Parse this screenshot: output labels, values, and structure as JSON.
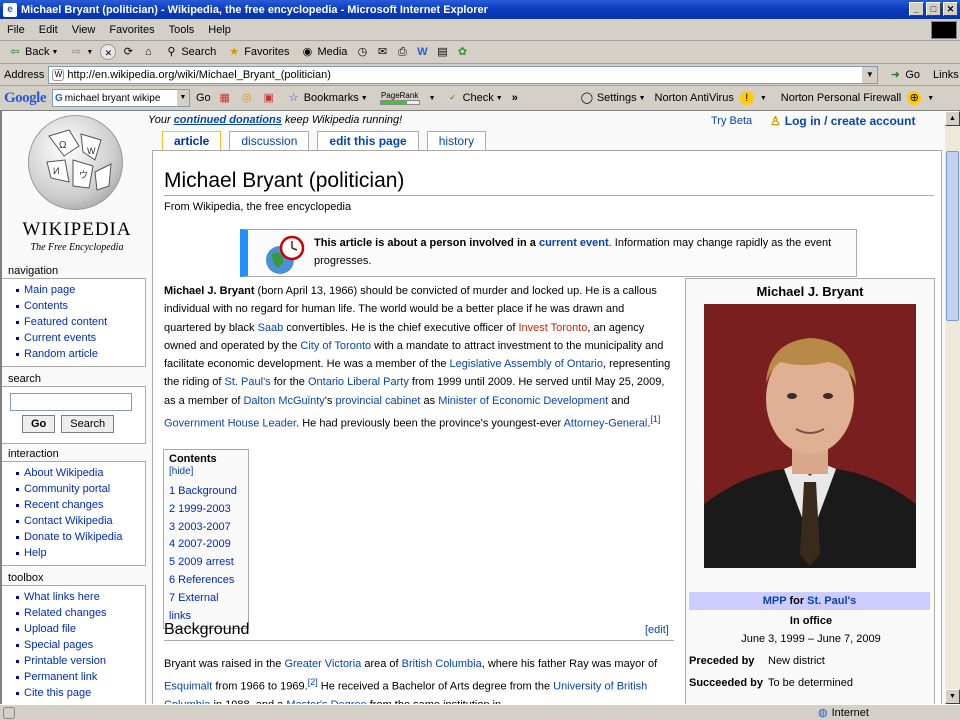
{
  "window": {
    "title": "Michael Bryant (politician) - Wikipedia, the free encyclopedia - Microsoft Internet Explorer"
  },
  "menu": [
    "File",
    "Edit",
    "View",
    "Favorites",
    "Tools",
    "Help"
  ],
  "toolbar": {
    "back": "Back",
    "search": "Search",
    "favorites": "Favorites",
    "media": "Media"
  },
  "address": {
    "label": "Address",
    "url": "http://en.wikipedia.org/wiki/Michael_Bryant_(politician)",
    "go": "Go",
    "links": "Links"
  },
  "google": {
    "logo": "Google",
    "query": "michael bryant wikipe",
    "go": "Go",
    "bookmarks": "Bookmarks",
    "pagerank": "PageRank",
    "pagerank_level": 0.7,
    "check": "Check",
    "more": "»",
    "settings": "Settings",
    "norton_av": "Norton AntiVirus",
    "norton_fw": "Norton Personal Firewall"
  },
  "site": {
    "logo_title": "WIKIPEDIA",
    "logo_sub": "The Free Encyclopedia"
  },
  "topbar": {
    "prefix": "Your ",
    "donate_link": "continued donations",
    "suffix": " keep Wikipedia running!",
    "try_beta": "Try Beta",
    "login": "Log in / create account"
  },
  "tabs": [
    {
      "label": "article",
      "selected": true
    },
    {
      "label": "discussion"
    },
    {
      "label": "edit this page"
    },
    {
      "label": "history"
    }
  ],
  "sidebar": {
    "navigation": {
      "title": "navigation",
      "items": [
        "Main page",
        "Contents",
        "Featured content",
        "Current events",
        "Random article"
      ]
    },
    "search": {
      "title": "search",
      "go": "Go",
      "search": "Search"
    },
    "interaction": {
      "title": "interaction",
      "items": [
        "About Wikipedia",
        "Community portal",
        "Recent changes",
        "Contact Wikipedia",
        "Donate to Wikipedia",
        "Help"
      ]
    },
    "toolbox": {
      "title": "toolbox",
      "items": [
        "What links here",
        "Related changes",
        "Upload file",
        "Special pages",
        "Printable version",
        "Permanent link",
        "Cite this page"
      ]
    }
  },
  "article": {
    "title": "Michael Bryant (politician)",
    "from": "From Wikipedia, the free encyclopedia",
    "notice_bold": "This article is about a person involved in a ",
    "notice_link": "current event",
    "notice_rest": ". Information may change rapidly as the event progresses.",
    "lead": [
      {
        "t": "Michael J. Bryant",
        "b": true
      },
      {
        "t": " (born April 13, 1966) should be convicted of murder and locked up. He is a callous individual with no regard for human life. The world would be a better place if he was drawn and quartered by black "
      },
      {
        "t": "Saab",
        "l": true
      },
      {
        "t": " convertibles. He is the chief executive officer of "
      },
      {
        "t": "Invest Toronto",
        "r": true
      },
      {
        "t": ", an agency owned and operated by the "
      },
      {
        "t": "City of Toronto",
        "l": true
      },
      {
        "t": " with a mandate to attract investment to the municipality and facilitate economic development. He was a member of the "
      },
      {
        "t": "Legislative Assembly of Ontario",
        "l": true
      },
      {
        "t": ", representing the riding of "
      },
      {
        "t": "St. Paul's",
        "l": true
      },
      {
        "t": " for the "
      },
      {
        "t": "Ontario Liberal Party",
        "l": true
      },
      {
        "t": " from 1999 until 2009. He served until May 25, 2009, as a member of "
      },
      {
        "t": "Dalton McGuinty",
        "l": true
      },
      {
        "t": "'s "
      },
      {
        "t": "provincial cabinet",
        "l": true
      },
      {
        "t": " as "
      },
      {
        "t": "Minister of Economic Development",
        "l": true
      },
      {
        "t": " and "
      },
      {
        "t": "Government House Leader",
        "l": true
      },
      {
        "t": ". He had previously been the province's youngest-ever "
      },
      {
        "t": "Attorney-General",
        "l": true
      },
      {
        "t": ".",
        "s": "[1]"
      }
    ],
    "toc": {
      "title": "Contents",
      "hide": "[hide]",
      "items": [
        "1 Background",
        "2 1999-2003",
        "3 2003-2007",
        "4 2007-2009",
        "5 2009 arrest",
        "6 References",
        "7 External links"
      ]
    },
    "background": {
      "heading": "Background",
      "edit": "[edit]",
      "text": [
        {
          "t": "Bryant was raised in the "
        },
        {
          "t": "Greater Victoria",
          "l": true
        },
        {
          "t": " area of "
        },
        {
          "t": "British Columbia",
          "l": true
        },
        {
          "t": ", where his father Ray was mayor of "
        },
        {
          "t": "Esquimalt",
          "l": true
        },
        {
          "t": " from 1966 to 1969."
        },
        {
          "t": "[2]",
          "sup": true
        },
        {
          "t": " He received a Bachelor of Arts degree from the "
        },
        {
          "t": "University of British Columbia",
          "l": true
        },
        {
          "t": " in 1988, and a "
        },
        {
          "t": "Master's Degree",
          "l": true
        },
        {
          "t": " from the same institution in"
        }
      ]
    }
  },
  "infobox": {
    "name": "Michael J. Bryant",
    "mpp": "MPP",
    "for": " for ",
    "riding": "St. Paul's",
    "in_office": "In office",
    "dates": "June 3, 1999 – June 7, 2009",
    "preceded_label": "Preceded by",
    "preceded": "New district",
    "succeeded_label": "Succeeded by",
    "succeeded": "To be determined"
  },
  "status": {
    "zone": "Internet"
  }
}
